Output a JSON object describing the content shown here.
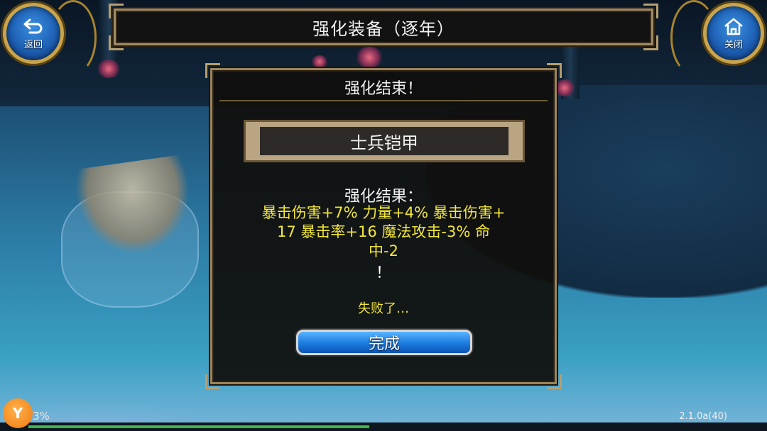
{
  "header": {
    "title": "强化装备（逐年）",
    "back_label": "返回",
    "close_label": "关闭"
  },
  "dialog": {
    "title": "强化结束！",
    "item_name": "士兵铠甲",
    "result_heading": "强化结果：",
    "result_lines": [
      "暴击伤害+7% 力量+4% 暴击伤害+",
      "17 暴击率+16 魔法攻击-3% 命",
      "中-2"
    ],
    "result_end": "！",
    "status": "失败了…",
    "done_label": "完成"
  },
  "footer": {
    "logo_text": "Y",
    "percent": "3%",
    "progress": 0.48,
    "version": "2.1.0a(40)"
  },
  "colors": {
    "result_text": "#f2e63a",
    "button_blue": "#1f7fe0",
    "frame_gold": "#9c8458"
  }
}
